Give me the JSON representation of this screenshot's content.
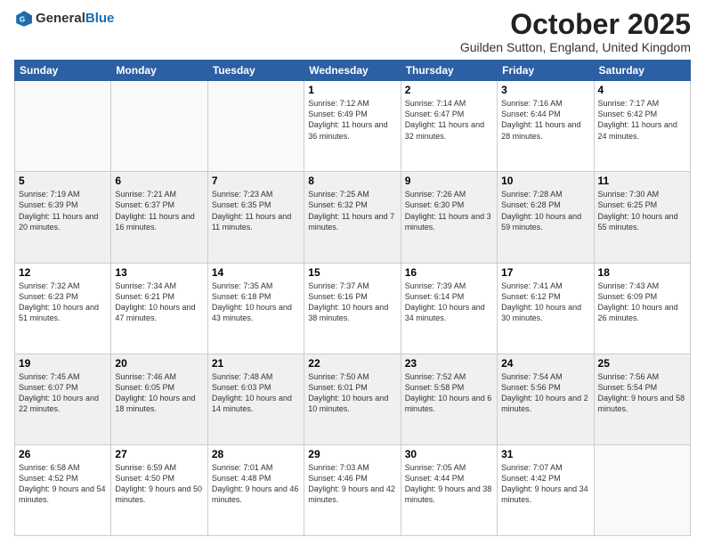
{
  "header": {
    "logo_general": "General",
    "logo_blue": "Blue",
    "month_title": "October 2025",
    "location": "Guilden Sutton, England, United Kingdom"
  },
  "days_of_week": [
    "Sunday",
    "Monday",
    "Tuesday",
    "Wednesday",
    "Thursday",
    "Friday",
    "Saturday"
  ],
  "weeks": [
    {
      "shaded": false,
      "days": [
        {
          "date": "",
          "sunrise": "",
          "sunset": "",
          "daylight": ""
        },
        {
          "date": "",
          "sunrise": "",
          "sunset": "",
          "daylight": ""
        },
        {
          "date": "",
          "sunrise": "",
          "sunset": "",
          "daylight": ""
        },
        {
          "date": "1",
          "sunrise": "Sunrise: 7:12 AM",
          "sunset": "Sunset: 6:49 PM",
          "daylight": "Daylight: 11 hours and 36 minutes."
        },
        {
          "date": "2",
          "sunrise": "Sunrise: 7:14 AM",
          "sunset": "Sunset: 6:47 PM",
          "daylight": "Daylight: 11 hours and 32 minutes."
        },
        {
          "date": "3",
          "sunrise": "Sunrise: 7:16 AM",
          "sunset": "Sunset: 6:44 PM",
          "daylight": "Daylight: 11 hours and 28 minutes."
        },
        {
          "date": "4",
          "sunrise": "Sunrise: 7:17 AM",
          "sunset": "Sunset: 6:42 PM",
          "daylight": "Daylight: 11 hours and 24 minutes."
        }
      ]
    },
    {
      "shaded": true,
      "days": [
        {
          "date": "5",
          "sunrise": "Sunrise: 7:19 AM",
          "sunset": "Sunset: 6:39 PM",
          "daylight": "Daylight: 11 hours and 20 minutes."
        },
        {
          "date": "6",
          "sunrise": "Sunrise: 7:21 AM",
          "sunset": "Sunset: 6:37 PM",
          "daylight": "Daylight: 11 hours and 16 minutes."
        },
        {
          "date": "7",
          "sunrise": "Sunrise: 7:23 AM",
          "sunset": "Sunset: 6:35 PM",
          "daylight": "Daylight: 11 hours and 11 minutes."
        },
        {
          "date": "8",
          "sunrise": "Sunrise: 7:25 AM",
          "sunset": "Sunset: 6:32 PM",
          "daylight": "Daylight: 11 hours and 7 minutes."
        },
        {
          "date": "9",
          "sunrise": "Sunrise: 7:26 AM",
          "sunset": "Sunset: 6:30 PM",
          "daylight": "Daylight: 11 hours and 3 minutes."
        },
        {
          "date": "10",
          "sunrise": "Sunrise: 7:28 AM",
          "sunset": "Sunset: 6:28 PM",
          "daylight": "Daylight: 10 hours and 59 minutes."
        },
        {
          "date": "11",
          "sunrise": "Sunrise: 7:30 AM",
          "sunset": "Sunset: 6:25 PM",
          "daylight": "Daylight: 10 hours and 55 minutes."
        }
      ]
    },
    {
      "shaded": false,
      "days": [
        {
          "date": "12",
          "sunrise": "Sunrise: 7:32 AM",
          "sunset": "Sunset: 6:23 PM",
          "daylight": "Daylight: 10 hours and 51 minutes."
        },
        {
          "date": "13",
          "sunrise": "Sunrise: 7:34 AM",
          "sunset": "Sunset: 6:21 PM",
          "daylight": "Daylight: 10 hours and 47 minutes."
        },
        {
          "date": "14",
          "sunrise": "Sunrise: 7:35 AM",
          "sunset": "Sunset: 6:18 PM",
          "daylight": "Daylight: 10 hours and 43 minutes."
        },
        {
          "date": "15",
          "sunrise": "Sunrise: 7:37 AM",
          "sunset": "Sunset: 6:16 PM",
          "daylight": "Daylight: 10 hours and 38 minutes."
        },
        {
          "date": "16",
          "sunrise": "Sunrise: 7:39 AM",
          "sunset": "Sunset: 6:14 PM",
          "daylight": "Daylight: 10 hours and 34 minutes."
        },
        {
          "date": "17",
          "sunrise": "Sunrise: 7:41 AM",
          "sunset": "Sunset: 6:12 PM",
          "daylight": "Daylight: 10 hours and 30 minutes."
        },
        {
          "date": "18",
          "sunrise": "Sunrise: 7:43 AM",
          "sunset": "Sunset: 6:09 PM",
          "daylight": "Daylight: 10 hours and 26 minutes."
        }
      ]
    },
    {
      "shaded": true,
      "days": [
        {
          "date": "19",
          "sunrise": "Sunrise: 7:45 AM",
          "sunset": "Sunset: 6:07 PM",
          "daylight": "Daylight: 10 hours and 22 minutes."
        },
        {
          "date": "20",
          "sunrise": "Sunrise: 7:46 AM",
          "sunset": "Sunset: 6:05 PM",
          "daylight": "Daylight: 10 hours and 18 minutes."
        },
        {
          "date": "21",
          "sunrise": "Sunrise: 7:48 AM",
          "sunset": "Sunset: 6:03 PM",
          "daylight": "Daylight: 10 hours and 14 minutes."
        },
        {
          "date": "22",
          "sunrise": "Sunrise: 7:50 AM",
          "sunset": "Sunset: 6:01 PM",
          "daylight": "Daylight: 10 hours and 10 minutes."
        },
        {
          "date": "23",
          "sunrise": "Sunrise: 7:52 AM",
          "sunset": "Sunset: 5:58 PM",
          "daylight": "Daylight: 10 hours and 6 minutes."
        },
        {
          "date": "24",
          "sunrise": "Sunrise: 7:54 AM",
          "sunset": "Sunset: 5:56 PM",
          "daylight": "Daylight: 10 hours and 2 minutes."
        },
        {
          "date": "25",
          "sunrise": "Sunrise: 7:56 AM",
          "sunset": "Sunset: 5:54 PM",
          "daylight": "Daylight: 9 hours and 58 minutes."
        }
      ]
    },
    {
      "shaded": false,
      "days": [
        {
          "date": "26",
          "sunrise": "Sunrise: 6:58 AM",
          "sunset": "Sunset: 4:52 PM",
          "daylight": "Daylight: 9 hours and 54 minutes."
        },
        {
          "date": "27",
          "sunrise": "Sunrise: 6:59 AM",
          "sunset": "Sunset: 4:50 PM",
          "daylight": "Daylight: 9 hours and 50 minutes."
        },
        {
          "date": "28",
          "sunrise": "Sunrise: 7:01 AM",
          "sunset": "Sunset: 4:48 PM",
          "daylight": "Daylight: 9 hours and 46 minutes."
        },
        {
          "date": "29",
          "sunrise": "Sunrise: 7:03 AM",
          "sunset": "Sunset: 4:46 PM",
          "daylight": "Daylight: 9 hours and 42 minutes."
        },
        {
          "date": "30",
          "sunrise": "Sunrise: 7:05 AM",
          "sunset": "Sunset: 4:44 PM",
          "daylight": "Daylight: 9 hours and 38 minutes."
        },
        {
          "date": "31",
          "sunrise": "Sunrise: 7:07 AM",
          "sunset": "Sunset: 4:42 PM",
          "daylight": "Daylight: 9 hours and 34 minutes."
        },
        {
          "date": "",
          "sunrise": "",
          "sunset": "",
          "daylight": ""
        }
      ]
    }
  ]
}
